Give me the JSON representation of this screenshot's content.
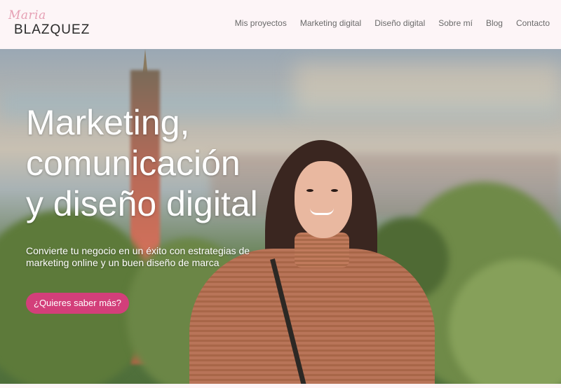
{
  "header": {
    "logo_script": "Maria",
    "logo_name": "BLAZQUEZ",
    "nav": [
      {
        "label": "Mis proyectos"
      },
      {
        "label": "Marketing digital"
      },
      {
        "label": "Diseño digital"
      },
      {
        "label": "Sobre mí"
      },
      {
        "label": "Blog"
      },
      {
        "label": "Contacto"
      }
    ]
  },
  "hero": {
    "title_lines": [
      "Marketing,",
      "comunicación",
      "y diseño digital"
    ],
    "subtitle": "Convierte tu negocio en un éxito con estrategias de marketing online y un buen diseño de marca",
    "cta_label": "¿Quieres saber más?"
  },
  "colors": {
    "accent": "#d33f7a",
    "logo_script": "#e6a0b4",
    "header_bg": "#fdf5f7",
    "nav_text": "#6a6a6a"
  }
}
